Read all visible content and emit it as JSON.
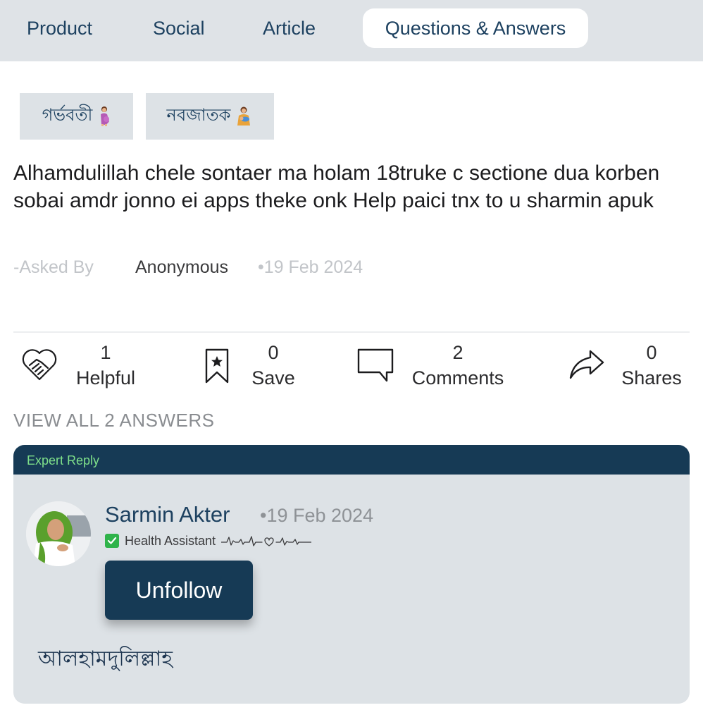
{
  "tabs": [
    {
      "label": "Product",
      "active": false
    },
    {
      "label": "Social",
      "active": false
    },
    {
      "label": "Article",
      "active": false
    },
    {
      "label": "Questions & Answers",
      "active": true
    }
  ],
  "categories": [
    {
      "label": "গর্ভবতী",
      "icon": "pregnant-woman-icon"
    },
    {
      "label": "নবজাতক",
      "icon": "breastfeeding-icon"
    }
  ],
  "question": {
    "text": "Alhamdulillah chele sontaer ma holam 18truke c sectione dua korben sobai amdr jonno ei apps theke onk Help paici tnx to u sharmin apuk",
    "asked_by_label": "-Asked By",
    "author": "Anonymous",
    "date": "•19 Feb 2024"
  },
  "actions": {
    "helpful": {
      "count": "1",
      "label": "Helpful",
      "icon": "handshake-heart-icon"
    },
    "save": {
      "count": "0",
      "label": "Save",
      "icon": "bookmark-star-icon"
    },
    "comments": {
      "count": "2",
      "label": "Comments",
      "icon": "comment-bubble-icon"
    },
    "shares": {
      "count": "0",
      "label": "Shares",
      "icon": "share-arrow-icon"
    }
  },
  "view_all_label": "VIEW ALL 2 ANSWERS",
  "expert_reply": {
    "header": "Expert Reply",
    "name": "Sarmin Akter",
    "date": "•19 Feb 2024",
    "role": "Health Assistant",
    "role_badge_icon": "check-mark-icon",
    "role_decoration_icon": "heartbeat-line-icon",
    "follow_button": "Unfollow",
    "answer_text": "আলহামদুলিল্লাহ"
  },
  "colors": {
    "primary": "#163a55",
    "tab_bar_bg": "#dfe3e7",
    "card_bg": "#dde2e6",
    "expert_label": "#7fe08a",
    "verified_green": "#2fb34a"
  }
}
